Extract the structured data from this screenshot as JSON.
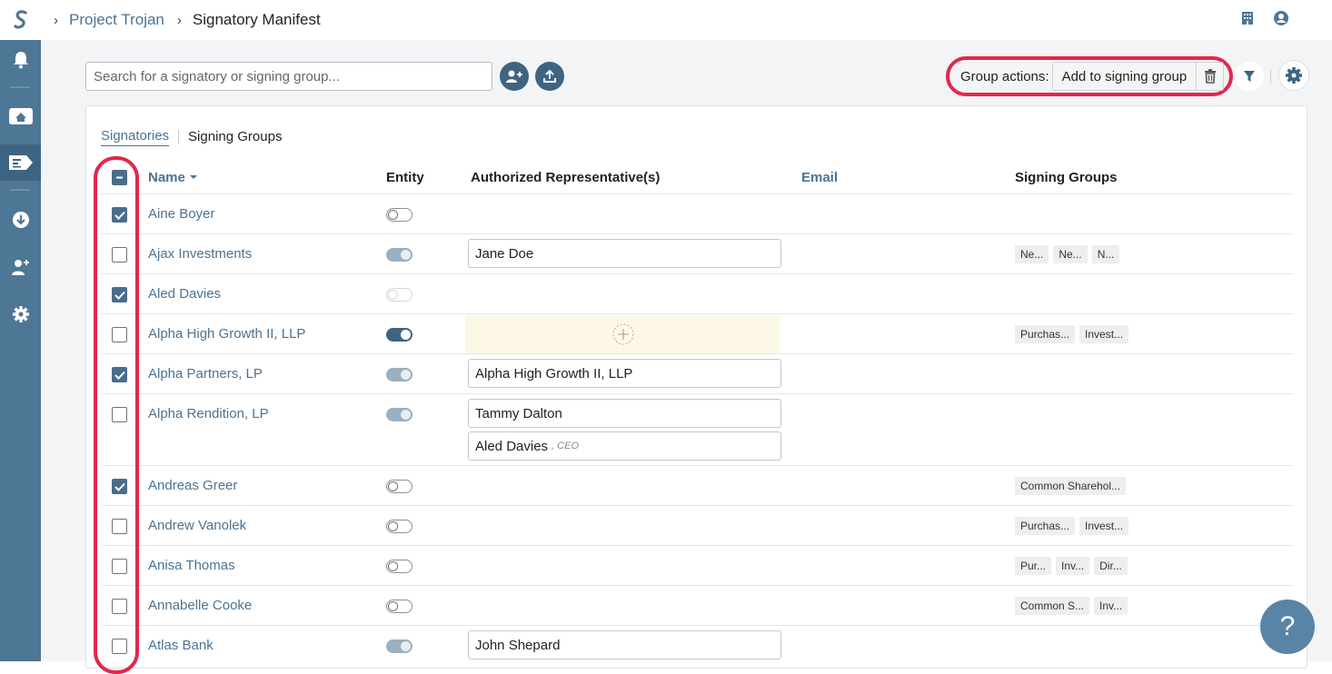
{
  "breadcrumb": {
    "project": "Project Trojan",
    "current": "Signatory Manifest"
  },
  "toolbar": {
    "search_placeholder": "Search for a signatory or signing group...",
    "group_actions_label": "Group actions:",
    "add_to_group_label": "Add to signing group"
  },
  "tabs": {
    "signatories": "Signatories",
    "signing_groups": "Signing Groups"
  },
  "columns": {
    "name": "Name",
    "entity": "Entity",
    "reps": "Authorized Representative(s)",
    "email": "Email",
    "groups": "Signing Groups"
  },
  "rows": [
    {
      "name": "Aine Boyer",
      "checked": true,
      "toggle": "off",
      "reps": [],
      "groups": []
    },
    {
      "name": "Ajax Investments",
      "checked": false,
      "toggle": "ondim",
      "reps": [
        {
          "name": "Jane Doe"
        }
      ],
      "groups": [
        "Ne...",
        "Ne...",
        "N..."
      ]
    },
    {
      "name": "Aled Davies",
      "checked": true,
      "toggle": "offdim",
      "reps": [],
      "groups": []
    },
    {
      "name": "Alpha High Growth II, LLP",
      "checked": false,
      "toggle": "onfull",
      "reps": "add",
      "groups": [
        "Purchas...",
        "Invest..."
      ]
    },
    {
      "name": "Alpha Partners, LP",
      "checked": true,
      "toggle": "ondim",
      "reps": [
        {
          "name": "Alpha High Growth II, LLP"
        }
      ],
      "groups": []
    },
    {
      "name": "Alpha Rendition, LP",
      "checked": false,
      "toggle": "ondim",
      "reps": [
        {
          "name": "Tammy Dalton"
        },
        {
          "name": "Aled Davies",
          "title": ", CEO"
        }
      ],
      "groups": []
    },
    {
      "name": "Andreas Greer",
      "checked": true,
      "toggle": "off",
      "reps": [],
      "groups": [
        "Common Sharehol..."
      ]
    },
    {
      "name": "Andrew Vanolek",
      "checked": false,
      "toggle": "off",
      "reps": [],
      "groups": [
        "Purchas...",
        "Invest..."
      ]
    },
    {
      "name": "Anisa Thomas",
      "checked": false,
      "toggle": "off",
      "reps": [],
      "groups": [
        "Pur...",
        "Inv...",
        "Dir..."
      ]
    },
    {
      "name": "Annabelle Cooke",
      "checked": false,
      "toggle": "off",
      "reps": [],
      "groups": [
        "Common S...",
        "Inv..."
      ]
    },
    {
      "name": "Atlas Bank",
      "checked": false,
      "toggle": "ondim",
      "reps": [
        {
          "name": "John Shepard"
        }
      ],
      "groups": []
    }
  ],
  "help_label": "?",
  "colors": {
    "sidebar": "#4e7695",
    "accent": "#4c7391",
    "highlight": "#e0284f"
  }
}
